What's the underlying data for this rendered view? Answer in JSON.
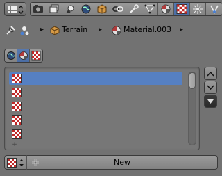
{
  "toolbar": {
    "editor_type_icon": "properties-editor-icon",
    "tabs": [
      {
        "name": "tab-render",
        "icon": "camera-icon",
        "active": false
      },
      {
        "name": "tab-render-layers",
        "icon": "render-layers-icon",
        "active": false
      },
      {
        "name": "tab-scene",
        "icon": "scene-icon",
        "active": false
      },
      {
        "name": "tab-world",
        "icon": "world-icon",
        "active": false
      },
      {
        "name": "tab-object",
        "icon": "object-icon",
        "active": false
      },
      {
        "name": "tab-constraints",
        "icon": "constraints-icon",
        "active": false
      },
      {
        "name": "tab-modifiers",
        "icon": "wrench-icon",
        "active": false
      },
      {
        "name": "tab-data",
        "icon": "mesh-data-icon",
        "active": false
      },
      {
        "name": "tab-material",
        "icon": "material-icon",
        "active": false
      },
      {
        "name": "tab-texture",
        "icon": "texture-icon",
        "active": true
      },
      {
        "name": "tab-particles",
        "icon": "particles-icon",
        "active": false
      },
      {
        "name": "tab-physics",
        "icon": "physics-icon",
        "active": false
      }
    ]
  },
  "breadcrumb": {
    "object_label": "Terrain",
    "material_label": "Material.003"
  },
  "context": {
    "buttons": [
      "world-texture-icon",
      "material-texture-icon",
      "brush-texture-icon"
    ],
    "active_index": 1
  },
  "slots": {
    "rows": [
      {
        "icon": "texture-icon",
        "selected": true
      },
      {
        "icon": "texture-icon",
        "selected": false
      },
      {
        "icon": "texture-icon",
        "selected": false
      },
      {
        "icon": "texture-icon",
        "selected": false
      },
      {
        "icon": "texture-icon",
        "selected": false
      }
    ]
  },
  "new_row": {
    "new_label": "New"
  },
  "colors": {
    "background": "#727272",
    "active_tab": "#5679b0",
    "selection": "#5680c2"
  }
}
